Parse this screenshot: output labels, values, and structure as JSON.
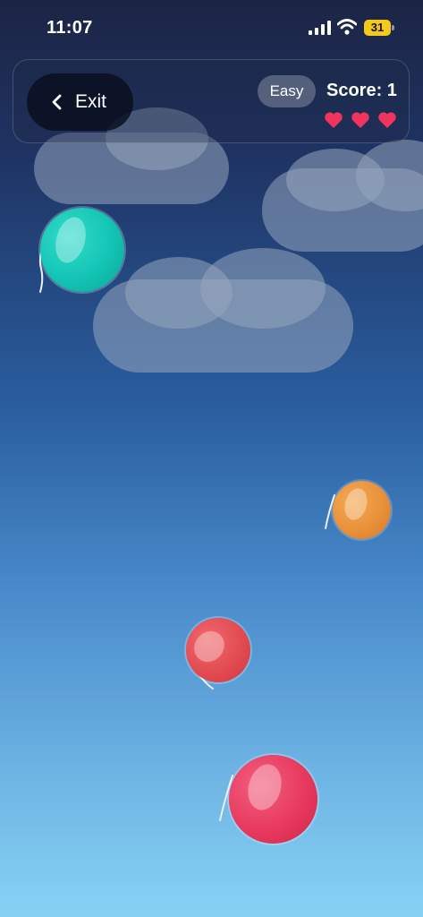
{
  "status_bar": {
    "time": "11:07",
    "battery_level": "31",
    "icons": [
      "signal-icon",
      "wifi-icon",
      "battery-icon"
    ]
  },
  "header": {
    "exit_label": "Exit",
    "exit_icon": "chevron-left-icon",
    "difficulty": "Easy",
    "score_text": "Score: 1",
    "lives": 3,
    "heart_color": "#f0345d"
  },
  "balloons": [
    {
      "color": "teal",
      "hex": "#13c4b4"
    },
    {
      "color": "orange",
      "hex": "#e8913a"
    },
    {
      "color": "red",
      "hex": "#e24b51"
    },
    {
      "color": "pink",
      "hex": "#e8395e"
    }
  ]
}
